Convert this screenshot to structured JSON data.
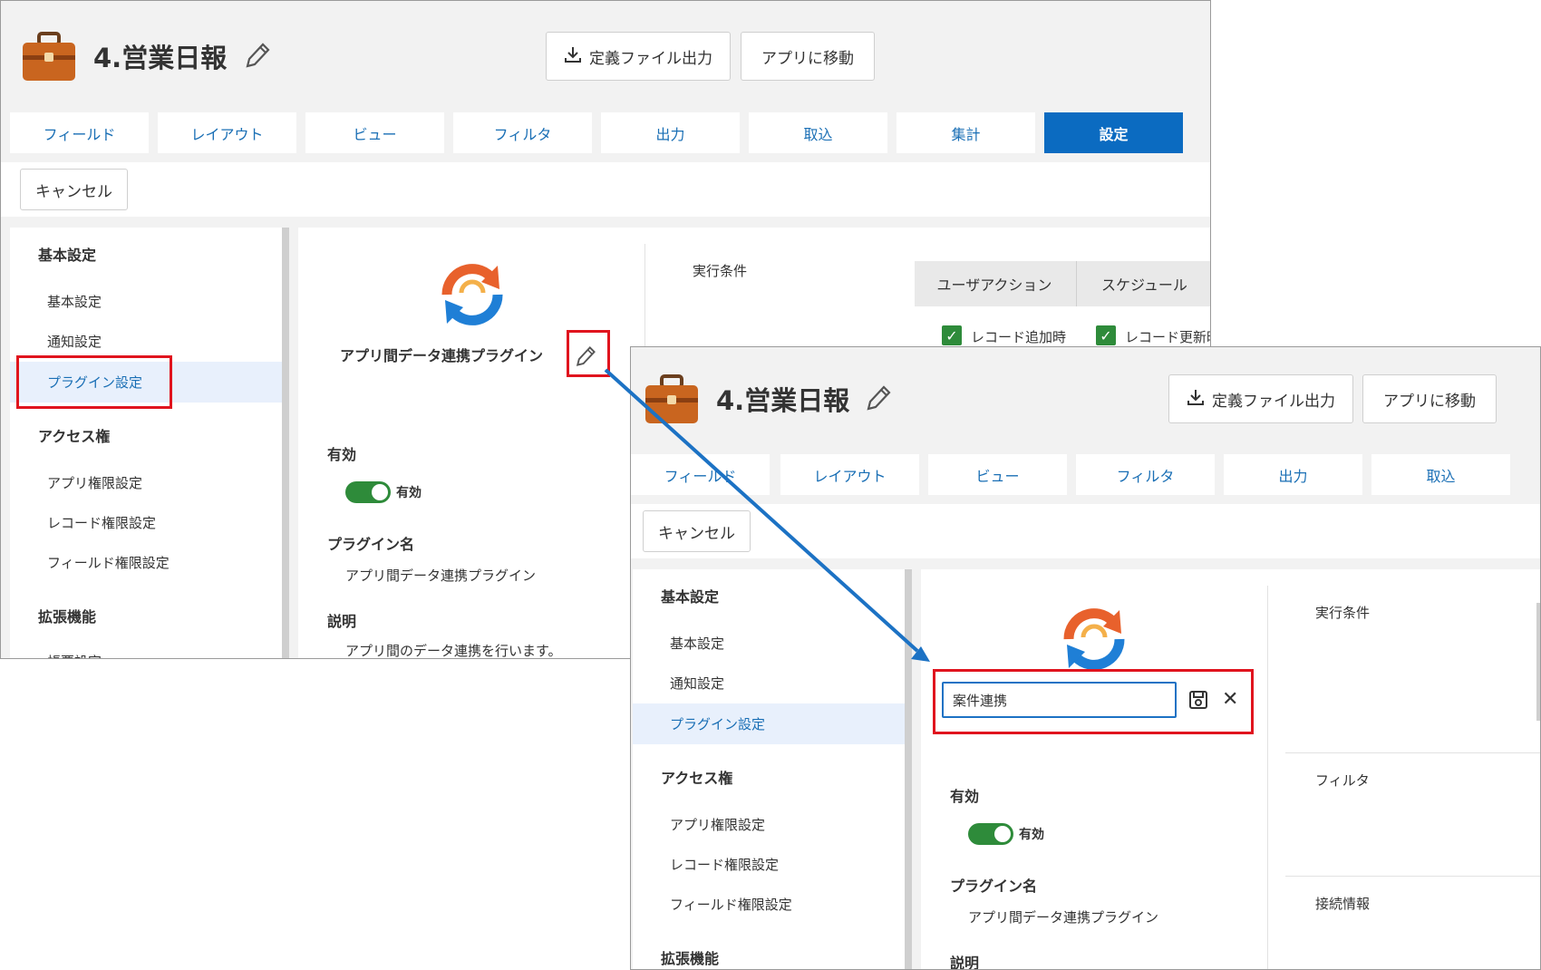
{
  "app": {
    "title": "4.営業日報"
  },
  "toolbar": {
    "export_label": "定義ファイル出力",
    "goto_app_label": "アプリに移動"
  },
  "tabs": [
    "フィールド",
    "レイアウト",
    "ビュー",
    "フィルタ",
    "出力",
    "取込",
    "集計",
    "設定"
  ],
  "active_tab": "設定",
  "cancel_label": "キャンセル",
  "sidebar": {
    "basic_heading": "基本設定",
    "basic_items": [
      "基本設定",
      "通知設定",
      "プラグイン設定"
    ],
    "access_heading": "アクセス権",
    "access_items": [
      "アプリ権限設定",
      "レコード権限設定",
      "フィールド権限設定"
    ],
    "ext_heading": "拡張機能",
    "ext_items": [
      "帳票設定"
    ]
  },
  "plugin": {
    "name_display": "アプリ間データ連携プラグイン",
    "name_input_value": "案件連携",
    "enabled_label": "有効",
    "enabled_state": "有効",
    "plugin_name_label": "プラグイン名",
    "plugin_name_value": "アプリ間データ連携プラグイン",
    "description_label": "説明",
    "description_value": "アプリ間のデータ連携を行います。"
  },
  "exec": {
    "label": "実行条件",
    "tabs": [
      "ユーザアクション",
      "スケジュール"
    ],
    "checks": [
      "レコード追加時",
      "レコード更新時"
    ],
    "filter_label": "フィルタ",
    "connection_label": "接続情報"
  },
  "colors": {
    "accent": "#0b6bc1",
    "link": "#1a6fb5",
    "highlight": "#e0141e",
    "toggle": "#2e8b3a"
  }
}
